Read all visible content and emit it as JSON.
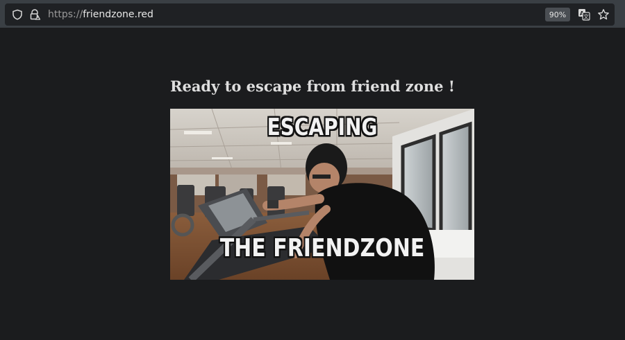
{
  "browser": {
    "url_scheme": "https://",
    "url_host": "friendzone.red",
    "zoom_level": "90%",
    "icons": {
      "shield": "shield-icon",
      "lock": "lock-warning-icon",
      "translate": "translate-icon",
      "bookmark": "star-icon"
    }
  },
  "page": {
    "headline": "Ready to escape from friend zone !",
    "image": {
      "caption_top": "ESCAPING",
      "caption_bottom": "THE FRIENDZONE"
    }
  },
  "colors": {
    "background": "#1b1c1e",
    "toolbar": "#3a3f44",
    "urlbar": "#1f2124",
    "headline": "#dedede"
  }
}
